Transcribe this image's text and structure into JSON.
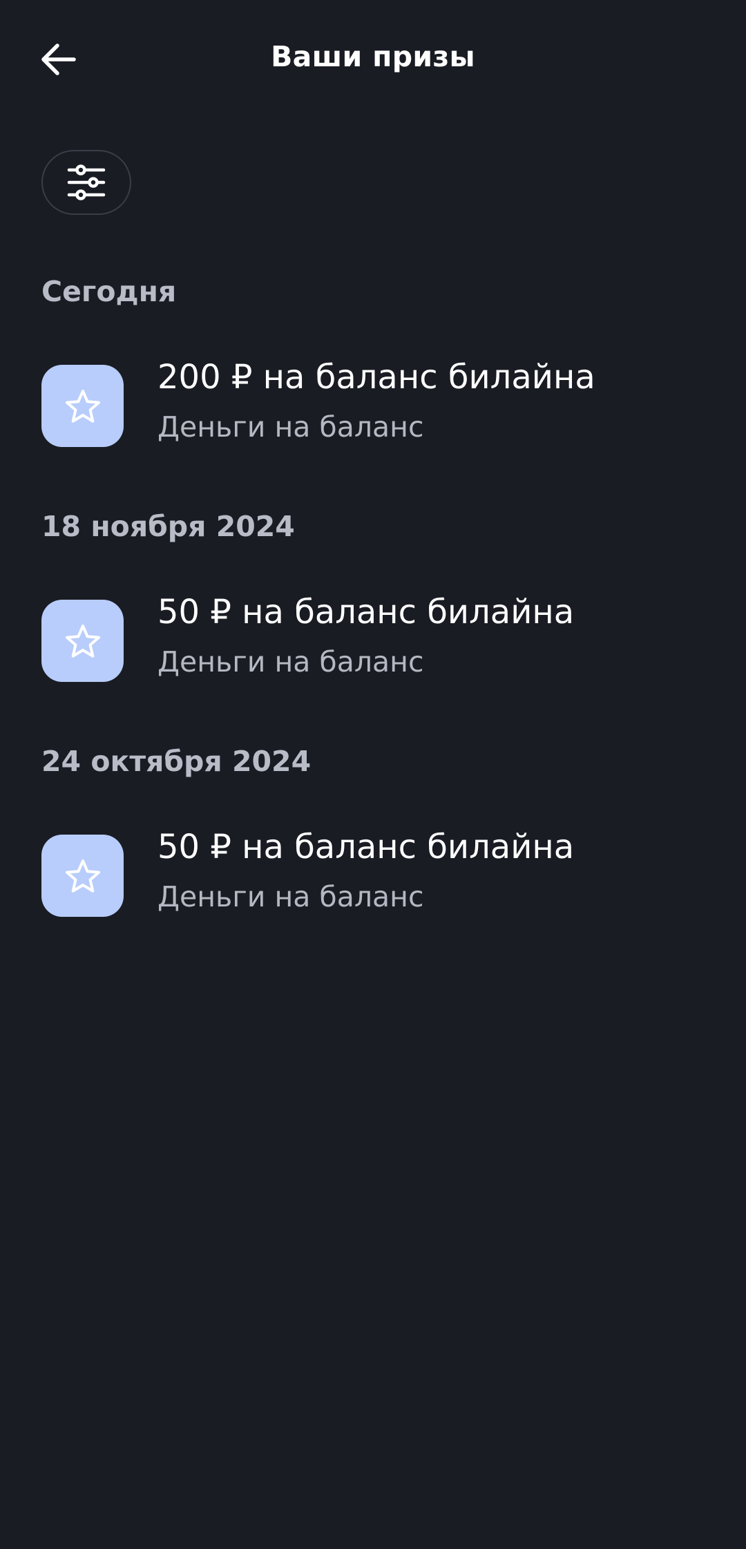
{
  "header": {
    "title": "Ваши призы",
    "back_icon": "arrow-left-icon"
  },
  "filter": {
    "icon": "sliders-icon"
  },
  "colors": {
    "background": "#191c23",
    "icon_tile": "#b8cdfb",
    "secondary_text": "#b4b8c2"
  },
  "sections": [
    {
      "date": "Сегодня",
      "items": [
        {
          "title": "200 ₽ на баланс билайна",
          "subtitle": "Деньги на баланс",
          "icon": "star-icon"
        }
      ]
    },
    {
      "date": "18 ноября 2024",
      "items": [
        {
          "title": "50 ₽ на баланс билайна",
          "subtitle": "Деньги на баланс",
          "icon": "star-icon"
        }
      ]
    },
    {
      "date": "24 октября 2024",
      "items": [
        {
          "title": "50 ₽ на баланс билайна",
          "subtitle": "Деньги на баланс",
          "icon": "star-icon"
        }
      ]
    }
  ]
}
